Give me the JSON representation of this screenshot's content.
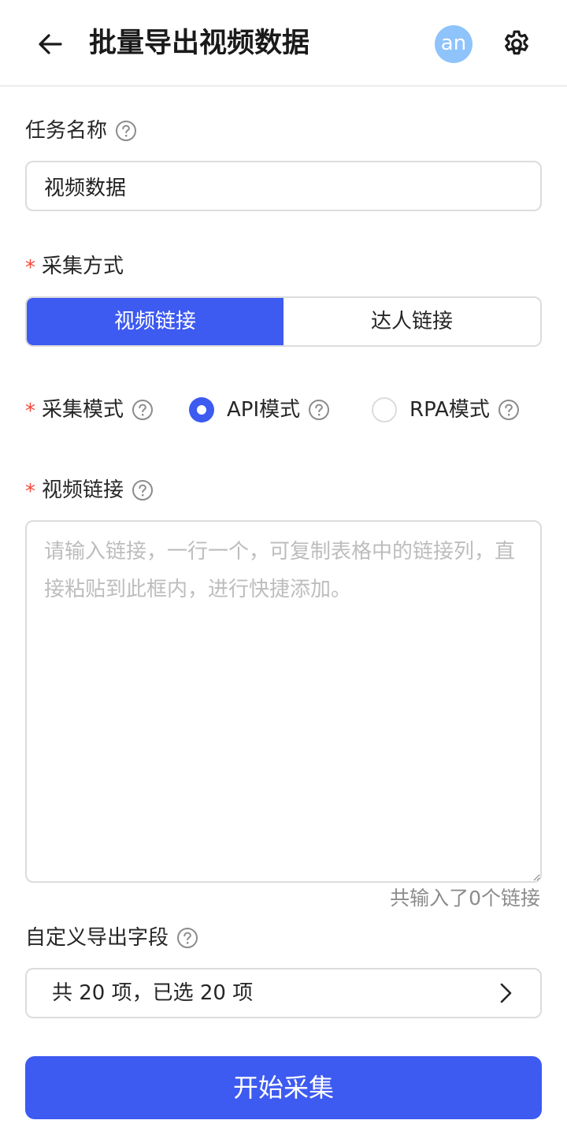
{
  "header": {
    "title": "批量导出视频数据",
    "avatar_text": "an",
    "back_icon": "arrow-left-icon",
    "settings_icon": "gear-icon"
  },
  "task_name": {
    "label": "任务名称",
    "value": "视频数据"
  },
  "collect_method": {
    "label": "采集方式",
    "required_mark": "*",
    "options": [
      "视频链接",
      "达人链接"
    ],
    "selected": "视频链接"
  },
  "collect_mode": {
    "label": "采集模式",
    "required_mark": "*",
    "options": [
      "API模式",
      "RPA模式"
    ],
    "selected": "API模式"
  },
  "video_links": {
    "label": "视频链接",
    "required_mark": "*",
    "placeholder": "请输入链接，一行一个，可复制表格中的链接列，直接粘贴到此框内，进行快捷添加。",
    "value": "",
    "count_text": "共输入了0个链接"
  },
  "export_fields": {
    "label": "自定义导出字段",
    "summary": "共 20 项，已选 20 项"
  },
  "submit": {
    "label": "开始采集"
  },
  "colors": {
    "primary": "#3d5af1",
    "required": "#f5483b",
    "avatar_bg": "#8fc3fb",
    "border": "#dcdcdc"
  }
}
